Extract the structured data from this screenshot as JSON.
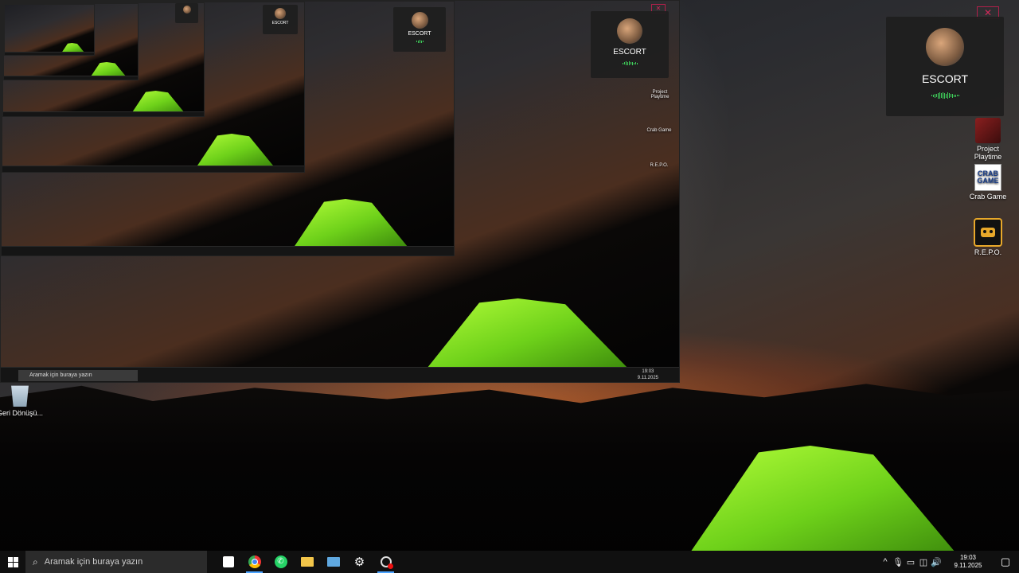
{
  "overlay": {
    "name": "ESCORT"
  },
  "desktop_icons": {
    "project_playtime": "Project Playtime",
    "crab_game": "Crab Game",
    "crab_logo": "CRAB GAME",
    "repo": "R.E.P.O.",
    "recycle_bin": "Geri Dönüşü..."
  },
  "taskbar": {
    "search_placeholder": "Aramak için buraya yazın",
    "time": "19:03",
    "date": "9.11.2025",
    "apps": [
      "store-icon",
      "chrome-icon",
      "whatsapp-icon",
      "file-explorer-icon",
      "mail-icon",
      "settings-icon",
      "screen-recorder-icon"
    ],
    "tray": [
      "chevron-up-icon",
      "microphone-icon",
      "network-icon",
      "wifi-icon",
      "volume-icon"
    ]
  },
  "colors": {
    "taskbar_bg": "#101010",
    "search_bg": "#2b2b2b",
    "tent": "#7ddc1f",
    "wave": "#3ecf5a",
    "close_accent": "#d02a5a"
  }
}
